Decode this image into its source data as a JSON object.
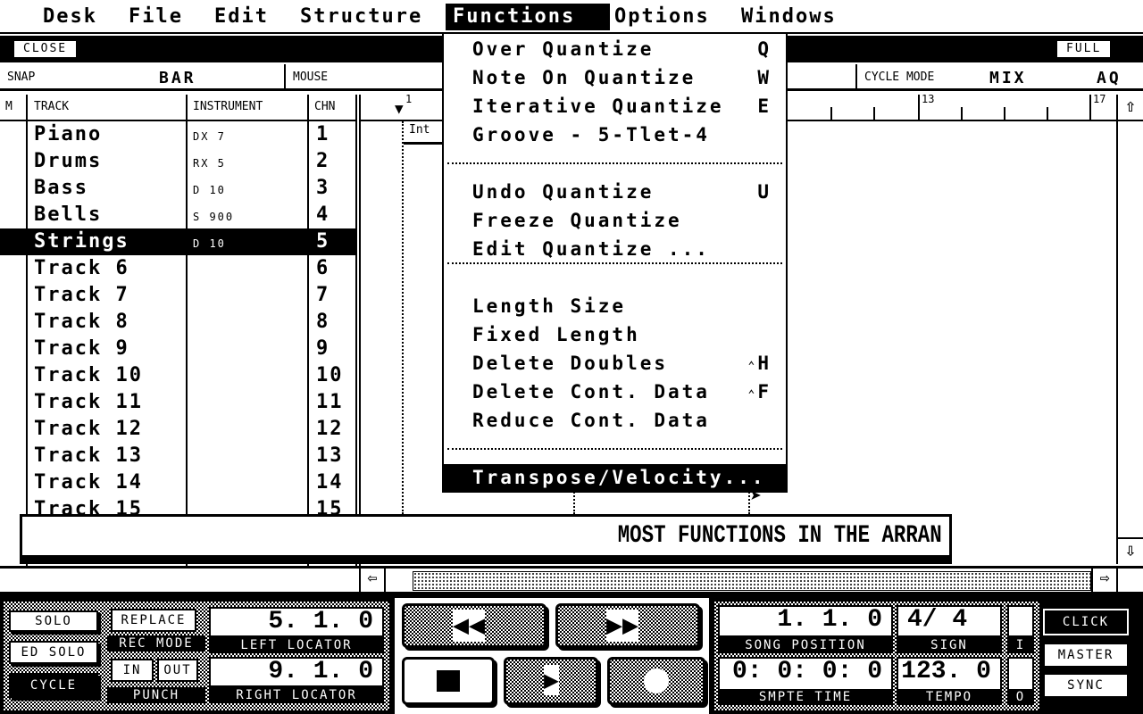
{
  "menubar": {
    "items": [
      "Desk",
      "File",
      "Edit",
      "Structure",
      "Functions",
      "Options",
      "Windows"
    ],
    "active": "Functions"
  },
  "window": {
    "close_label": "CLOSE",
    "full_label": "FULL"
  },
  "info": {
    "snap_label": "SNAP",
    "snap_value": "BAR",
    "mouse_label": "MOUSE",
    "cycle_mode_label": "CYCLE MODE",
    "cycle_mode_value": "MIX",
    "aq_label": "AQ"
  },
  "track_list": {
    "headers": {
      "m": "M",
      "track": "TRACK",
      "instrument": "INSTRUMENT",
      "chn": "CHN"
    },
    "rows": [
      {
        "track": "Piano",
        "instrument": "DX 7",
        "chn": "1"
      },
      {
        "track": "Drums",
        "instrument": "RX 5",
        "chn": "2"
      },
      {
        "track": "Bass",
        "instrument": "D 10",
        "chn": "3"
      },
      {
        "track": "Bells",
        "instrument": "S 900",
        "chn": "4"
      },
      {
        "track": "Strings",
        "instrument": "D 10",
        "chn": "5",
        "selected": true
      },
      {
        "track": "Track 6",
        "instrument": "",
        "chn": "6"
      },
      {
        "track": "Track 7",
        "instrument": "",
        "chn": "7"
      },
      {
        "track": "Track 8",
        "instrument": "",
        "chn": "8"
      },
      {
        "track": "Track 9",
        "instrument": "",
        "chn": "9"
      },
      {
        "track": "Track 10",
        "instrument": "",
        "chn": "10"
      },
      {
        "track": "Track 11",
        "instrument": "",
        "chn": "11"
      },
      {
        "track": "Track 12",
        "instrument": "",
        "chn": "12"
      },
      {
        "track": "Track 13",
        "instrument": "",
        "chn": "13"
      },
      {
        "track": "Track 14",
        "instrument": "",
        "chn": "14"
      },
      {
        "track": "Track 15",
        "instrument": "",
        "chn": "15"
      }
    ]
  },
  "ruler": {
    "marks": [
      "1",
      "13",
      "17"
    ]
  },
  "arrange": {
    "part_label": "Int"
  },
  "functions_menu": {
    "items": [
      {
        "label": "Over Quantize",
        "shortcut": "Q"
      },
      {
        "label": "Note On Quantize",
        "shortcut": "W"
      },
      {
        "label": "Iterative Quantize",
        "shortcut": "E"
      },
      {
        "label": "Groove - 5-Tlet-4",
        "shortcut": ""
      },
      {
        "label": "Undo Quantize",
        "shortcut": "U"
      },
      {
        "label": "Freeze Quantize",
        "shortcut": ""
      },
      {
        "label": "Edit Quantize ...",
        "shortcut": ""
      },
      {
        "label": "Length Size",
        "shortcut": ""
      },
      {
        "label": "Fixed Length",
        "shortcut": ""
      },
      {
        "label": "Delete Doubles",
        "shortcut": "H",
        "modifier": "control-icon"
      },
      {
        "label": "Delete Cont. Data",
        "shortcut": "F",
        "modifier": "control-icon"
      },
      {
        "label": "Reduce Cont. Data",
        "shortcut": ""
      },
      {
        "label": "Transpose/Velocity...",
        "shortcut": "",
        "highlighted": true
      }
    ]
  },
  "status_message": "MOST FUNCTIONS IN THE ARRAN",
  "transport": {
    "solo": "SOLO",
    "ed_solo": "ED SOLO",
    "cycle": "CYCLE",
    "rec_mode_value": "REPLACE",
    "rec_mode_label": "REC MODE",
    "punch_in": "IN",
    "punch_out": "OUT",
    "punch_label": "PUNCH",
    "left_locator_value": "5. 1.  0",
    "left_locator_label": "LEFT LOCATOR",
    "right_locator_value": "9. 1.  0",
    "right_locator_label": "RIGHT LOCATOR",
    "song_position_value": "1. 1.  0",
    "song_position_label": "SONG POSITION",
    "sign_value": "4/ 4",
    "sign_label": "SIGN",
    "smpte_value": "0: 0: 0: 0",
    "smpte_label": "SMPTE TIME",
    "tempo_value": "123.  0",
    "tempo_label": "TEMPO",
    "in_indicator": "I",
    "out_indicator": "O",
    "click": "CLICK",
    "master": "MASTER",
    "sync": "SYNC"
  }
}
